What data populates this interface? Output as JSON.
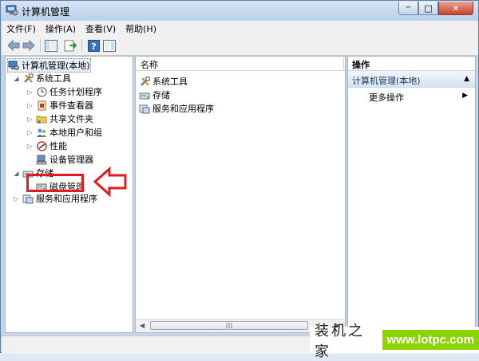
{
  "window": {
    "title": "计算机管理",
    "minimize_glyph": "─",
    "maximize_glyph": "□",
    "close_glyph": "✕"
  },
  "menu": {
    "items": [
      "文件(F)",
      "操作(A)",
      "查看(V)",
      "帮助(H)"
    ]
  },
  "tree": {
    "root": "计算机管理(本地)",
    "system_tools": "系统工具",
    "task_scheduler": "任务计划程序",
    "event_viewer": "事件查看器",
    "shared_folders": "共享文件夹",
    "local_users": "本地用户和组",
    "performance": "性能",
    "device_manager": "设备管理器",
    "storage": "存储",
    "disk_management": "磁盘管理",
    "services_apps": "服务和应用程序"
  },
  "middle": {
    "column_name": "名称",
    "rows": [
      "系统工具",
      "存储",
      "服务和应用程序"
    ]
  },
  "actions": {
    "header": "操作",
    "section": "计算机管理(本地)",
    "more": "更多操作"
  },
  "watermark": {
    "text": "装机之家",
    "url": "www.lotpc.com"
  },
  "colors": {
    "highlight": "#e01b22",
    "watermark_green": "#8bd400"
  }
}
